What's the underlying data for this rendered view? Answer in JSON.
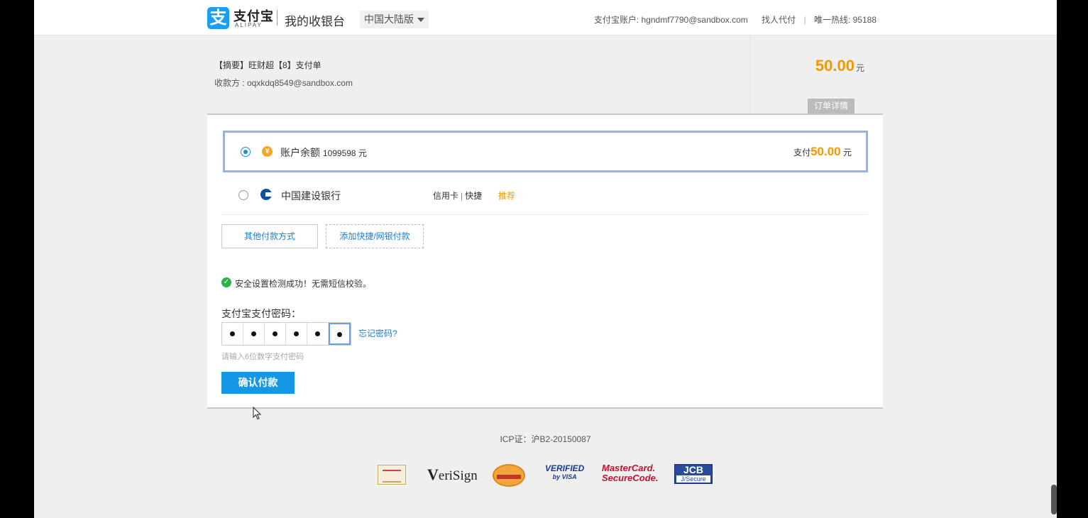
{
  "header": {
    "logo_mark": "支",
    "logo_cn": "支付宝",
    "logo_en": "ALIPAY",
    "product_title": "我的收银台",
    "region": "中国大陆版",
    "account_label": "支付宝账户: hgndmf7790@sandbox.com",
    "find_payer": "找人代付",
    "separator": "|",
    "hotline": "唯一热线: 95188"
  },
  "order": {
    "title": "【摘要】旺财超【8】支付单",
    "payee": "收款方 : oqxkdq8549@sandbox.com",
    "amount": "50.00",
    "unit": "元",
    "detail_tab": "订单详情"
  },
  "payment_options": [
    {
      "name": "账户余额",
      "balance": "1099598 元",
      "selected": true,
      "pay_prefix": "支付",
      "pay_amount": "50.00",
      "pay_unit": "元"
    },
    {
      "name": "中国建设银行",
      "card_type_1": "信用卡",
      "separator": "|",
      "card_type_2": "快捷",
      "badge": "推荐",
      "selected": false
    }
  ],
  "actions": {
    "other_methods": "其他付款方式",
    "add_method": "添加快捷/网银付款"
  },
  "security": {
    "message": "安全设置检测成功！无需短信校验。"
  },
  "password": {
    "label": "支付宝支付密码：",
    "filled_digits": 6,
    "total_digits": 6,
    "forgot": "忘记密码?",
    "hint": "请输入6位数字支付密码"
  },
  "confirm_button": "确认付款",
  "footer": {
    "icp": "ICP证：沪B2-20150087",
    "verisign": "eriSign",
    "verisign_v": "V",
    "visa_line1": "VERIFIED",
    "visa_line2": "by VISA",
    "mc_line1": "MasterCard.",
    "mc_line2": "SecureCode.",
    "jcb_line1": "JCB",
    "jcb_line2": "J/Secure"
  },
  "colors": {
    "accent_blue": "#1497e5",
    "amount_orange": "#f39800",
    "success_green": "#2ab24a"
  }
}
